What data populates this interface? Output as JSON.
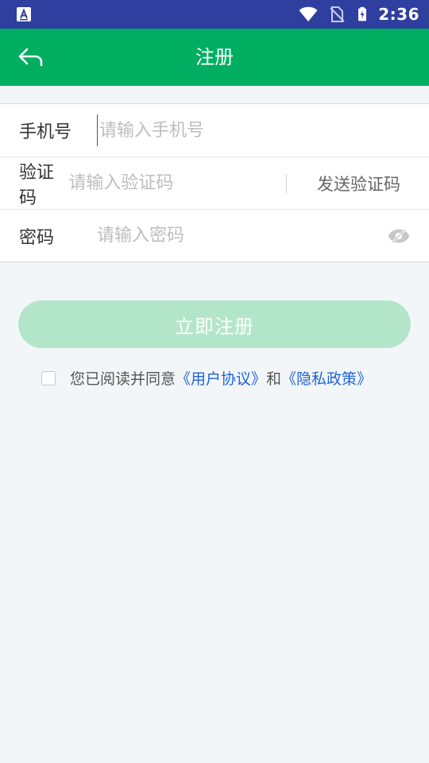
{
  "status_bar": {
    "time": "2:36",
    "icons": [
      "notification-a-icon",
      "wifi-icon",
      "no-sim-icon",
      "battery-charging-icon"
    ]
  },
  "header": {
    "title": "注册",
    "back_icon": "back-arrow-icon"
  },
  "form": {
    "phone": {
      "label": "手机号",
      "placeholder": "请输入手机号",
      "value": ""
    },
    "code": {
      "label": "验证码",
      "placeholder": "请输入验证码",
      "value": "",
      "send_label": "发送验证码"
    },
    "password": {
      "label": "密码",
      "placeholder": "请输入密码",
      "value": "",
      "toggle_icon": "eye-hidden-icon"
    }
  },
  "register_button": {
    "label": "立即注册"
  },
  "agreement": {
    "checked": false,
    "text": "您已阅读并同意",
    "user_agreement": "《用户协议》",
    "and": "和",
    "privacy_policy": "《隐私政策》"
  },
  "colors": {
    "status_bar": "#2f3f9f",
    "app_bar": "#00ae62",
    "button_disabled": "#b3e6c9",
    "link": "#1f63d9",
    "background": "#f3f6f8"
  }
}
